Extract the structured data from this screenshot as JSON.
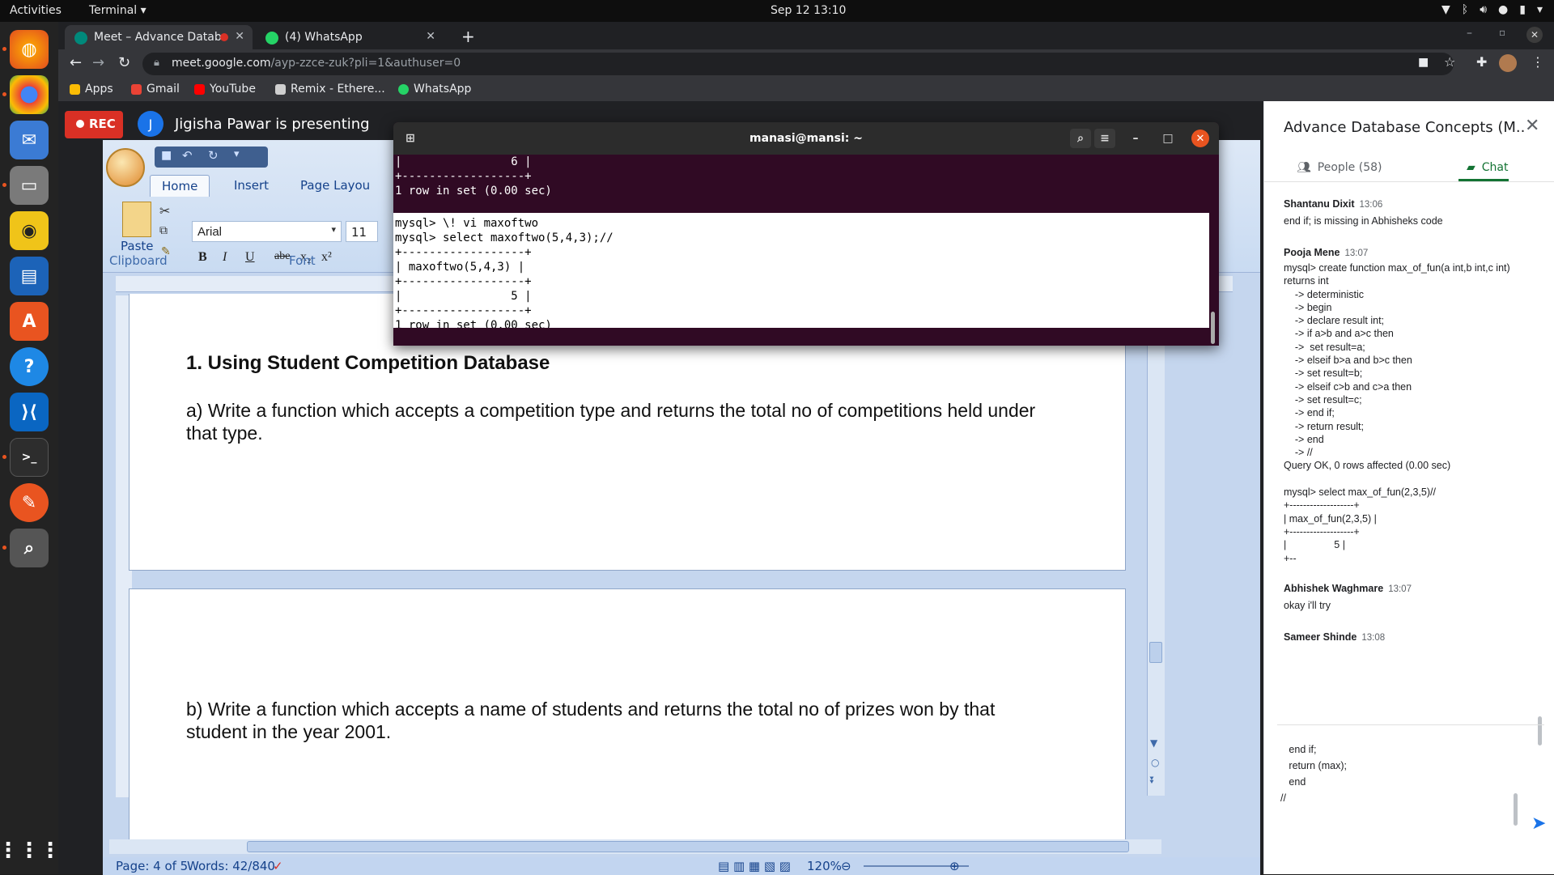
{
  "topbar": {
    "activities": "Activities",
    "app_menu": "Terminal ▾",
    "clock": "Sep 12  13:10"
  },
  "browser": {
    "tabs": [
      {
        "label": "Meet – Advance Datab",
        "favicon_color": "#00897b",
        "recording": true
      },
      {
        "label": "(4) WhatsApp",
        "favicon_color": "#25d366",
        "recording": false
      }
    ],
    "url_host": "meet.google.com",
    "url_path": "/ayp-zzce-zuk?pli=1&authuser=0",
    "bookmarks": [
      {
        "label": "Apps",
        "icon_color": "#fbbc04"
      },
      {
        "label": "Gmail",
        "icon_color": "#ea4335"
      },
      {
        "label": "YouTube",
        "icon_color": "#ff0000"
      },
      {
        "label": "Remix - Ethere...",
        "icon_color": "#cfcfcf"
      },
      {
        "label": "WhatsApp",
        "icon_color": "#25d366"
      }
    ]
  },
  "meet": {
    "rec_label": "REC",
    "presenter_initial": "J",
    "presenter_text": "Jigisha Pawar is presenting"
  },
  "word": {
    "tabs": [
      "Home",
      "Insert",
      "Page Layou"
    ],
    "paste_label": "Paste",
    "clipboard_label": "Clipboard",
    "font_label": "Font",
    "font_name": "Arial",
    "font_size": "11",
    "heading": "1.  Using  Student Competition Database",
    "question_a": "a) Write a function which accepts a competition type and returns the total no of competitions held under that type.",
    "question_b": "b) Write a function which accepts a name of students and returns the total no of prizes won by that student in the year 2001.",
    "status_page": "Page: 4 of 5",
    "status_words": "Words: 42/840",
    "zoom": "120%"
  },
  "terminal": {
    "title": "manasi@mansi: ~",
    "top_lines": "|                6 |\n+------------------+\n1 row in set (0.00 sec)",
    "mid_lines": "mysql> \\! vi maxoftwo\nmysql> select maxoftwo(5,4,3);//\n+------------------+\n| maxoftwo(5,4,3) |\n+------------------+\n|                5 |\n+------------------+\n1 row in set (0.00 sec)"
  },
  "panel": {
    "title": "Advance Database Concepts (M...",
    "people_tab": "People (58)",
    "chat_tab": "Chat",
    "messages": [
      {
        "author": "Shantanu Dixit",
        "time": "13:06",
        "text": "end if; is missing in Abhisheks code"
      },
      {
        "author": "Pooja Mene",
        "time": "13:07",
        "text": "mysql> create function max_of_fun(a int,b int,c int)\nreturns int\n    -> deterministic\n    -> begin\n    -> declare result int;\n    -> if a>b and a>c then\n    ->  set result=a;\n    -> elseif b>a and b>c then\n    -> set result=b;\n    -> elseif c>b and c>a then\n    -> set result=c;\n    -> end if;\n    -> return result;\n    -> end\n    -> //\nQuery OK, 0 rows affected (0.00 sec)\n\nmysql> select max_of_fun(2,3,5)//\n+-------------------+\n| max_of_fun(2,3,5) |\n+-------------------+\n|                 5 |\n+--"
      },
      {
        "author": "Abhishek Waghmare",
        "time": "13:07",
        "text": "okay i'll try"
      },
      {
        "author": "Sameer Shinde",
        "time": "13:08",
        "text": ""
      }
    ],
    "compose_text": "   end if;\n   return (max);\n   end\n//"
  }
}
